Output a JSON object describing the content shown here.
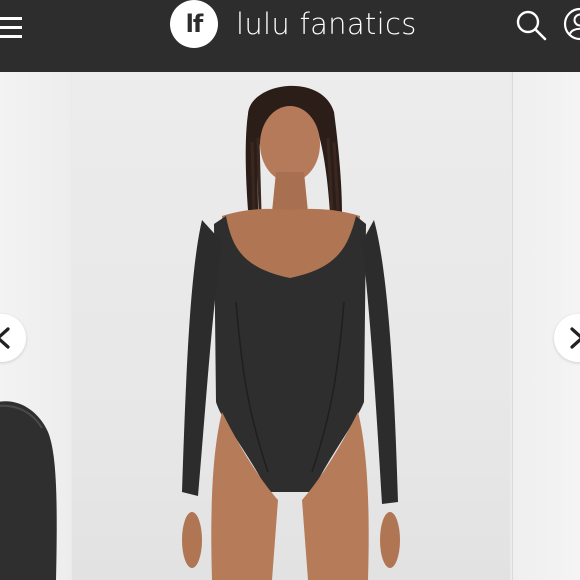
{
  "header": {
    "logo_mark": "lf",
    "brand_name": "lulu fanatics",
    "background": "#2d2d2d"
  },
  "icons": {
    "menu": "hamburger-menu-icon",
    "search": "search-icon",
    "account": "account-icon",
    "prev": "chevron-left-icon",
    "next": "chevron-right-icon"
  },
  "carousel": {
    "main_image": "model wearing dark grey long-sleeve scoop-neck bodysuit",
    "left_image": "partial view of dark grey sleeve",
    "right_image": "partial view of next product image"
  }
}
